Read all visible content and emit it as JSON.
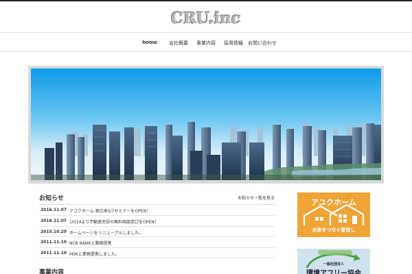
{
  "site": {
    "logo": "CRU.inc"
  },
  "nav": {
    "items": [
      {
        "label": "home"
      },
      {
        "label": "会社概要"
      },
      {
        "label": "事業内容"
      },
      {
        "label": "採用情報"
      },
      {
        "label": "お問い合わせ"
      }
    ]
  },
  "news": {
    "title": "お知らせ",
    "more_link": "お知らせ一覧を見る",
    "items": [
      {
        "date": "2016.11.07",
        "text": "アユクホーム 恵比寿5/7セミナーをOPEN！"
      },
      {
        "date": "2016.11.07",
        "text": "10/14より不動産売却の無料相談窓口をOPEN！"
      },
      {
        "date": "2015.10.29",
        "text": "ホームページをリニューアルしました。"
      },
      {
        "date": "2011.11.10",
        "text": "NCB BANKと業務提携"
      },
      {
        "date": "2011.11.10",
        "text": "MSKと業務提携しました。"
      }
    ]
  },
  "section2": {
    "title": "事業内容"
  },
  "banners": {
    "ayuku": {
      "title": "アユクホーム",
      "subtitle": "未来をつなぐ家探し",
      "color": "#f0a437"
    },
    "kankyo": {
      "top": "一般社団法人",
      "main": "環境アフリー協会",
      "color": "#cfe2ee"
    }
  }
}
